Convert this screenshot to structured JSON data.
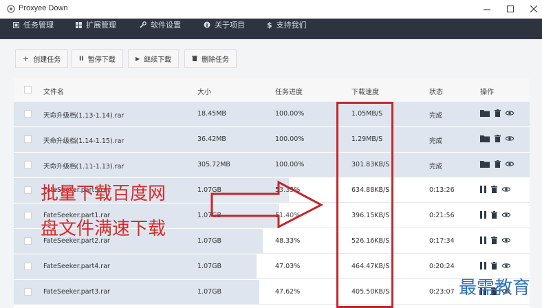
{
  "window": {
    "title": "Proxyee Down",
    "minimize_icon": "minimize-icon",
    "maximize_icon": "maximize-icon",
    "close_icon": "close-icon"
  },
  "nav": {
    "items": [
      {
        "label": "任务管理",
        "icon": "task-icon"
      },
      {
        "label": "扩展管理",
        "icon": "extension-icon"
      },
      {
        "label": "软件设置",
        "icon": "wrench-icon"
      },
      {
        "label": "关于项目",
        "icon": "info-icon"
      },
      {
        "label": "支持我们",
        "icon": "dollar-icon"
      }
    ]
  },
  "toolbar": {
    "create": "创建任务",
    "pause": "暂停下载",
    "resume": "继续下载",
    "delete": "删除任务"
  },
  "table": {
    "headers": [
      "文件名",
      "大小",
      "任务进度",
      "下载速度",
      "状态",
      "操作"
    ],
    "rows": [
      {
        "name": "天命升级档(1.13-1.14).rar",
        "size": "18.45MB",
        "progress": "100.00%",
        "speed": "1.05MB/S",
        "status": "完成",
        "fill": 1.0,
        "paused": false
      },
      {
        "name": "天命升级档(1.14-1.15).rar",
        "size": "36.42MB",
        "progress": "100.00%",
        "speed": "1.29MB/S",
        "status": "完成",
        "fill": 1.0,
        "paused": false
      },
      {
        "name": "天命升级档(1.11-1.13).rar",
        "size": "305.72MB",
        "progress": "100.00%",
        "speed": "301.83KB/S",
        "status": "完成",
        "fill": 1.0,
        "paused": false
      },
      {
        "name": "FateSeeker.part5.rar",
        "size": "1.07GB",
        "progress": "53.33%",
        "speed": "634.88KB/S",
        "status": "0:13:26",
        "fill": 0.5333,
        "paused": true
      },
      {
        "name": "FateSeeker.part1.rar",
        "size": "1.07GB",
        "progress": "51.40%",
        "speed": "396.15KB/S",
        "status": "0:21:56",
        "fill": 0.514,
        "paused": true
      },
      {
        "name": "FateSeeker.part2.rar",
        "size": "1.07GB",
        "progress": "48.33%",
        "speed": "526.16KB/S",
        "status": "0:17:34",
        "fill": 0.4833,
        "paused": true
      },
      {
        "name": "FateSeeker.part4.rar",
        "size": "1.07GB",
        "progress": "47.03%",
        "speed": "464.47KB/S",
        "status": "0:20:24",
        "fill": 0.4703,
        "paused": true
      },
      {
        "name": "FateSeeker.part3.rar",
        "size": "1.07GB",
        "progress": "47.62%",
        "speed": "405.50KB/S",
        "status": "0:23:07",
        "fill": 0.4762,
        "paused": true
      }
    ]
  },
  "annotation": {
    "line1": "批量下载百度网",
    "line2": "盘文件满速下载",
    "color": "#d52a2a"
  },
  "watermark": "最需教育"
}
